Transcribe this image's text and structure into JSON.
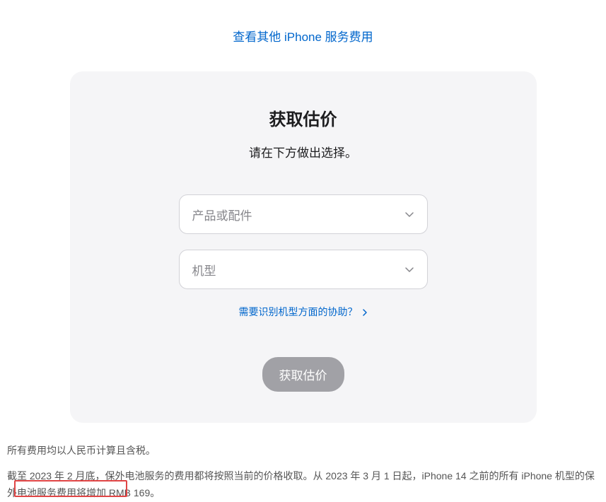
{
  "topLink": "查看其他 iPhone 服务费用",
  "card": {
    "title": "获取估价",
    "subtitle": "请在下方做出选择。",
    "select1Placeholder": "产品或配件",
    "select2Placeholder": "机型",
    "helpLink": "需要识别机型方面的协助？",
    "button": "获取估价"
  },
  "footnote1": "所有费用均以人民币计算且含税。",
  "footnote2": "截至 2023 年 2 月底，保外电池服务的费用都将按照当前的价格收取。从 2023 年 3 月 1 日起，iPhone 14 之前的所有 iPhone 机型的保外电池服务费用将增加 RMB 169。"
}
